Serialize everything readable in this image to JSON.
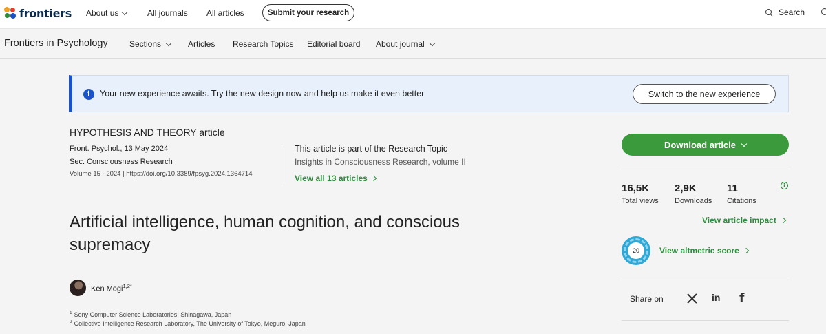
{
  "topnav": {
    "logo_text": "frontiers",
    "items": [
      "About us",
      "All journals",
      "All articles"
    ],
    "submit_label": "Submit your research",
    "search_label": "Search"
  },
  "journal_nav": {
    "title": "Frontiers in Psychology",
    "items": [
      "Sections",
      "Articles",
      "Research Topics",
      "Editorial board",
      "About journal"
    ]
  },
  "banner": {
    "message": "Your new experience awaits. Try the new design now and help us make it even better",
    "button_label": "Switch to the new experience",
    "accent_color": "#1a52c8"
  },
  "article": {
    "type": "HYPOTHESIS AND THEORY article",
    "journal_date": "Front. Psychol., 13 May 2024",
    "section": "Sec. Consciousness Research",
    "volume_doi": "Volume 15 - 2024 | https://doi.org/10.3389/fpsyg.2024.1364714",
    "research_topic_heading": "This article is part of the Research Topic",
    "research_topic_name": "Insights in Consciousness Research, volume II",
    "view_all_label": "View all 13 articles",
    "title": "Artificial intelligence, human cognition, and conscious supremacy",
    "author_name": "Ken Mogi",
    "author_sup": "1,2*",
    "affiliations": [
      {
        "num": "1",
        "text": "Sony Computer Science Laboratories, Shinagawa, Japan"
      },
      {
        "num": "2",
        "text": "Collective Intelligence Research Laboratory, The University of Tokyo, Meguro, Japan"
      }
    ]
  },
  "sidebar": {
    "download_label": "Download article",
    "metrics": [
      {
        "value": "16,5K",
        "label": "Total views"
      },
      {
        "value": "2,9K",
        "label": "Downloads"
      },
      {
        "value": "11",
        "label": "Citations"
      }
    ],
    "impact_label": "View article impact",
    "altmetric_score": "20",
    "altmetric_label": "View altmetric score",
    "share_label": "Share on",
    "social_icons": [
      "x-icon",
      "linkedin-icon",
      "facebook-icon"
    ],
    "brand_green": "#3b9a3b"
  }
}
